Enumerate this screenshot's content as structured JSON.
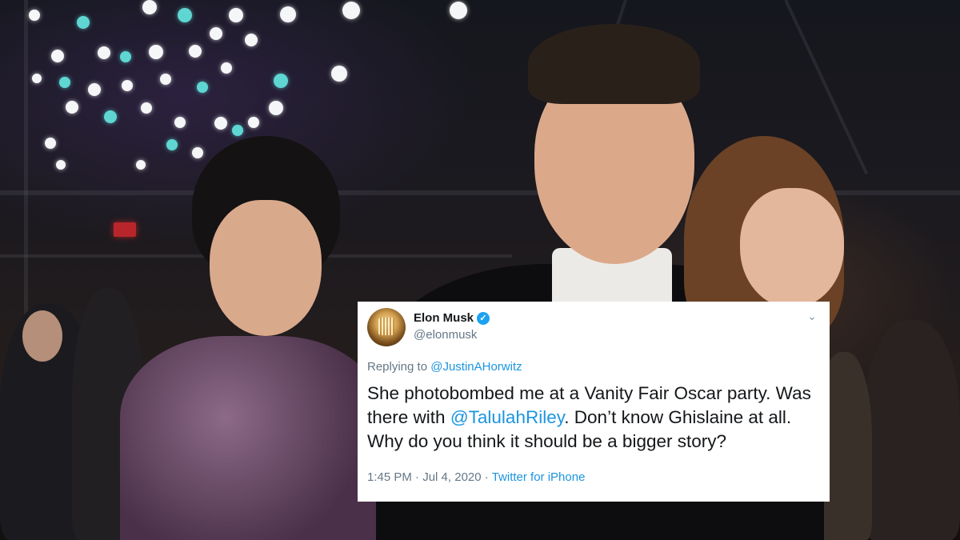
{
  "tweet": {
    "display_name": "Elon Musk",
    "handle": "@elonmusk",
    "verified_icon": "verified-badge-icon",
    "menu_icon": "chevron-down-icon",
    "replying_prefix": "Replying to",
    "replying_to": "@JustinAHorwitz",
    "text_part1": "She photobombed me at a Vanity Fair Oscar party. Was there with ",
    "text_mention": "@TalulahRiley",
    "text_part2": ". Don’t know Ghislaine at all. Why do you think it should be a bigger story?",
    "time": "1:45 PM",
    "separator": "·",
    "date": "Jul 4, 2020",
    "source": "Twitter for iPhone"
  },
  "colors": {
    "accent": "#1b95e0",
    "verified": "#1da1f2",
    "text_primary": "#14171a",
    "text_secondary": "#657786"
  }
}
